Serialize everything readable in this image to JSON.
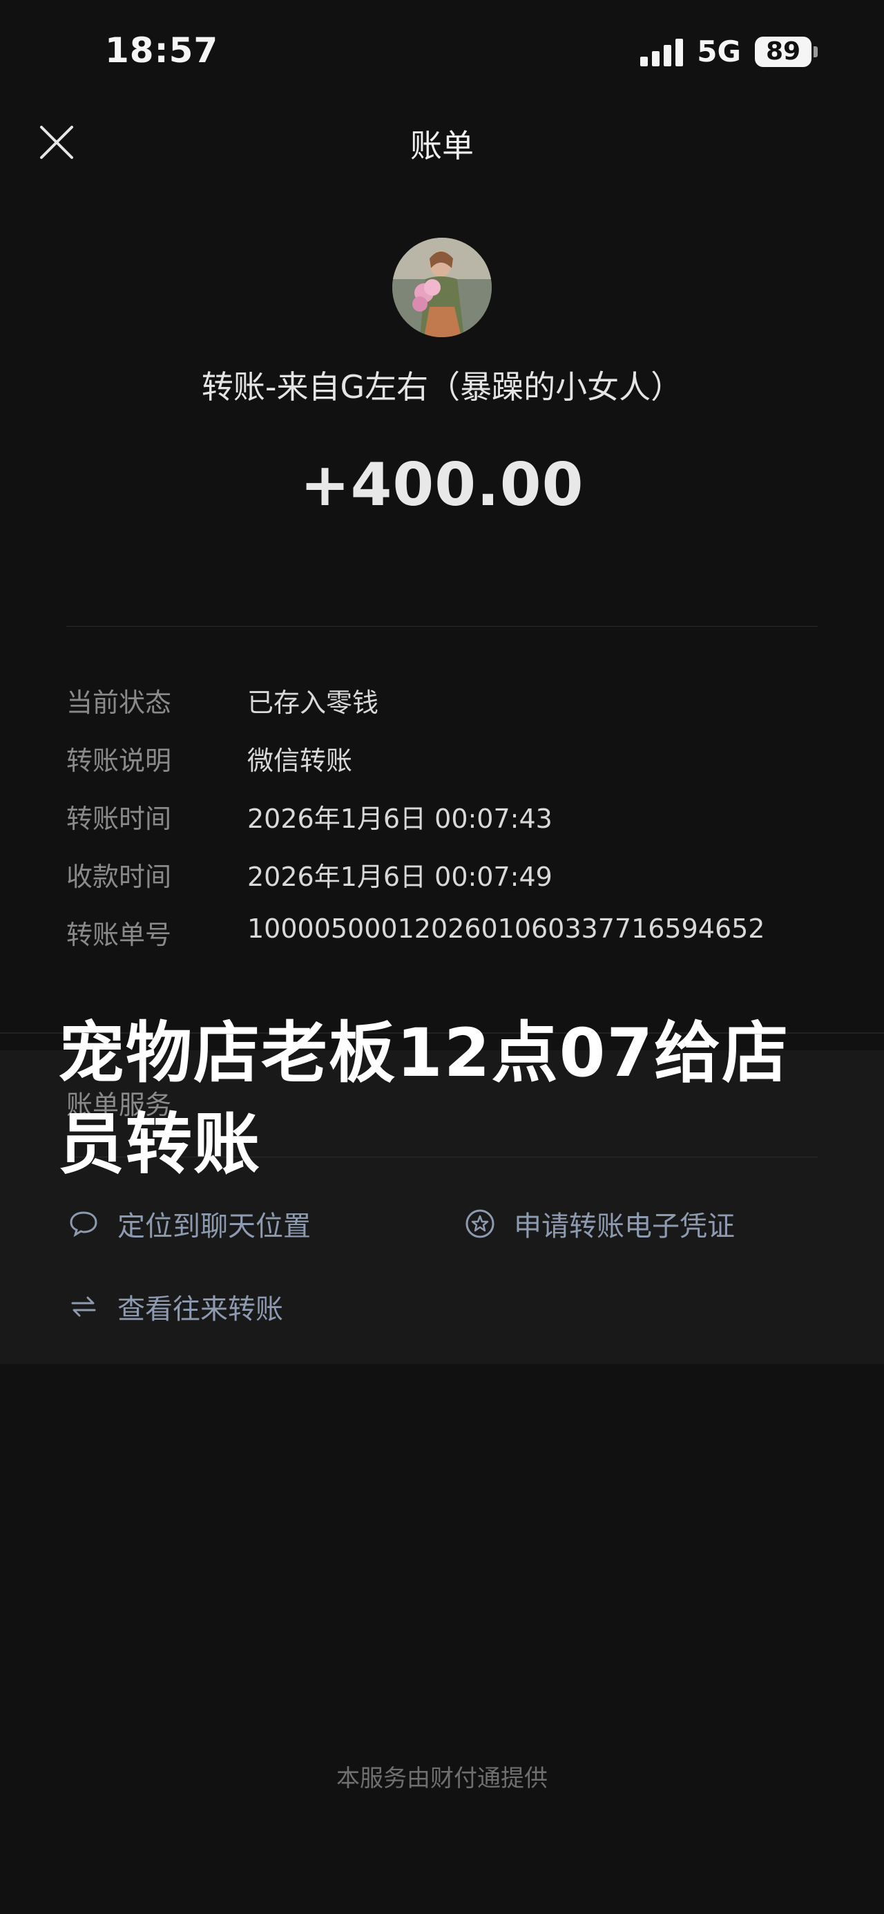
{
  "status_bar": {
    "time": "18:57",
    "network": "5G",
    "battery": "89"
  },
  "nav": {
    "title": "账单",
    "close_icon": "close-icon"
  },
  "transfer": {
    "payer": "转账-来自G左右（暴躁的小女人）",
    "amount": "+400.00"
  },
  "details": [
    {
      "label": "当前状态",
      "value": "已存入零钱"
    },
    {
      "label": "转账说明",
      "value": "微信转账"
    },
    {
      "label": "转账时间",
      "value": "2026年1月6日 00:07:43"
    },
    {
      "label": "收款时间",
      "value": "2026年1月6日 00:07:49"
    },
    {
      "label": "转账单号",
      "value": "1000050001202601060337716594652"
    }
  ],
  "services": {
    "title": "账单服务",
    "items": [
      {
        "label": "定位到聊天位置",
        "icon": "chat-bubble-icon"
      },
      {
        "label": "申请转账电子凭证",
        "icon": "star-badge-icon"
      },
      {
        "label": "查看往来转账",
        "icon": "swap-arrows-icon"
      }
    ]
  },
  "overlay_caption": {
    "line1": "宠物店老板12点07给店",
    "line2": "员转账"
  },
  "footer": "本服务由财付通提供",
  "colors": {
    "background": "#111111",
    "card": "#191919",
    "link": "#8e9ab0",
    "label": "#8a8a8a"
  }
}
